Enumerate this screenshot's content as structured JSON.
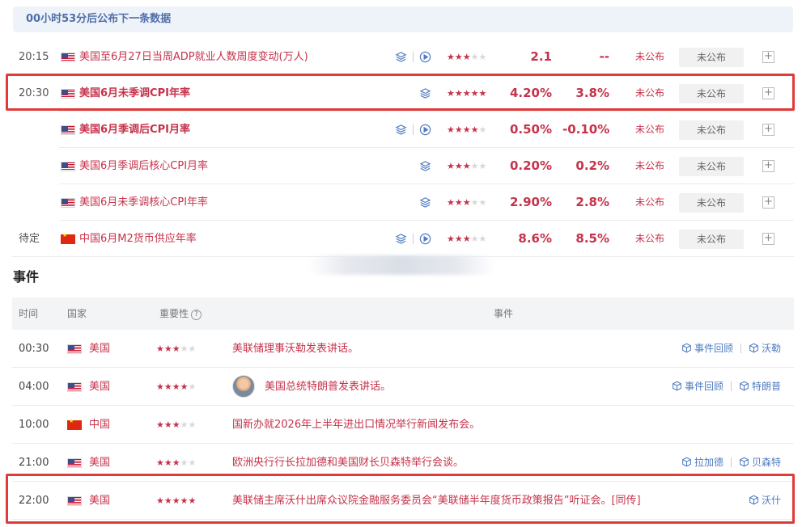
{
  "countdown": "00小时53分后公布下一条数据",
  "data_rows": [
    {
      "time": "20:15",
      "flag": "us",
      "name": "美国至6月27日当周ADP就业人数周度变动(万人)",
      "bold": false,
      "layers_icon": true,
      "play_icon": true,
      "stars": 3,
      "previous": "2.1",
      "consensus": "--",
      "actual": "未公布",
      "status": "未公布"
    },
    {
      "time": "20:30",
      "flag": "us",
      "name": "美国6月未季调CPI年率",
      "bold": true,
      "layers_icon": true,
      "play_icon": false,
      "stars": 5,
      "previous": "4.20%",
      "consensus": "3.8%",
      "actual": "未公布",
      "status": "未公布"
    },
    {
      "time": "",
      "flag": "us",
      "name": "美国6月季调后CPI月率",
      "bold": true,
      "layers_icon": true,
      "play_icon": true,
      "stars": 4,
      "previous": "0.50%",
      "consensus": "-0.10%",
      "actual": "未公布",
      "status": "未公布"
    },
    {
      "time": "",
      "flag": "us",
      "name": "美国6月季调后核心CPI月率",
      "bold": false,
      "layers_icon": true,
      "play_icon": false,
      "stars": 3,
      "previous": "0.20%",
      "consensus": "0.2%",
      "actual": "未公布",
      "status": "未公布"
    },
    {
      "time": "",
      "flag": "us",
      "name": "美国6月未季调核心CPI年率",
      "bold": false,
      "layers_icon": true,
      "play_icon": false,
      "stars": 3,
      "previous": "2.90%",
      "consensus": "2.8%",
      "actual": "未公布",
      "status": "未公布"
    },
    {
      "time": "待定",
      "flag": "cn",
      "name": "中国6月M2货币供应年率",
      "bold": false,
      "layers_icon": true,
      "play_icon": true,
      "stars": 3,
      "previous": "8.6%",
      "consensus": "8.5%",
      "actual": "未公布",
      "status": "未公布"
    }
  ],
  "events": {
    "title": "事件",
    "headers": {
      "time": "时间",
      "country": "国家",
      "importance": "重要性",
      "help": "?",
      "event": "事件"
    },
    "rows": [
      {
        "time": "00:30",
        "flag": "us",
        "country": "美国",
        "stars": 3,
        "avatar": false,
        "text": "美联储理事沃勒发表讲话。",
        "links": [
          "事件回顾",
          "沃勒"
        ]
      },
      {
        "time": "04:00",
        "flag": "us",
        "country": "美国",
        "stars": 4,
        "avatar": true,
        "text": "美国总统特朗普发表讲话。",
        "links": [
          "事件回顾",
          "特朗普"
        ]
      },
      {
        "time": "10:00",
        "flag": "cn",
        "country": "中国",
        "stars": 3,
        "avatar": false,
        "text": "国新办就2026年上半年进出口情况举行新闻发布会。",
        "links": []
      },
      {
        "time": "21:00",
        "flag": "us",
        "country": "美国",
        "stars": 3,
        "avatar": false,
        "text": "欧洲央行行长拉加德和美国财长贝森特举行会谈。",
        "links": [
          "拉加德",
          "贝森特"
        ]
      },
      {
        "time": "22:00",
        "flag": "us",
        "country": "美国",
        "stars": 5,
        "avatar": false,
        "text": "美联储主席沃什出席众议院金融服务委员会“美联储半年度货币政策报告”听证会。[同传]",
        "links": [
          "沃什"
        ]
      }
    ]
  },
  "colors": {
    "accent_red": "#c6324a",
    "link_blue": "#4f7cc0",
    "highlight": "#e03a3a"
  }
}
